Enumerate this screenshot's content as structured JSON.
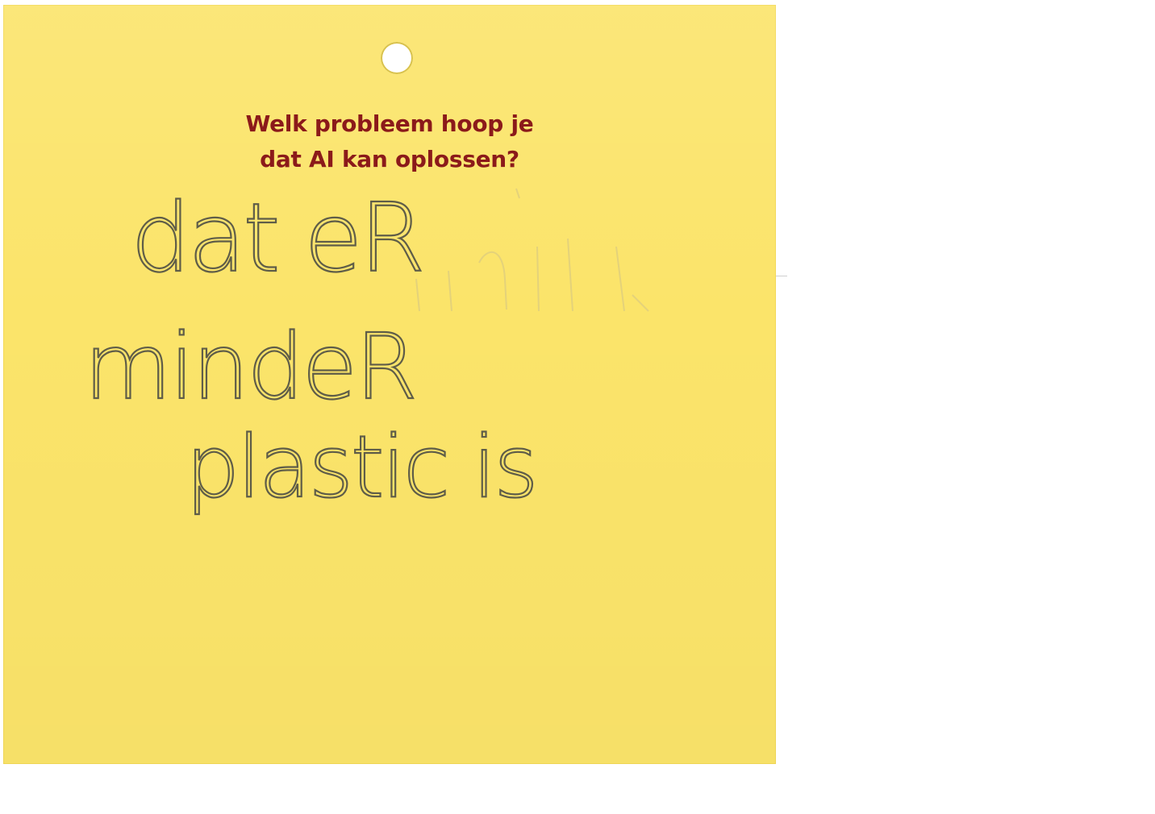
{
  "card": {
    "question_line1": "Welk probleem hoop je",
    "question_line2": "dat AI kan oplossen?",
    "answer_line1": "dat eR",
    "answer_line2": "mindeR",
    "answer_line3": "plastic is"
  },
  "colors": {
    "card_background": "#fbe46a",
    "question_text": "#8b1a1a",
    "handwriting_ink": "#5f5d48"
  }
}
